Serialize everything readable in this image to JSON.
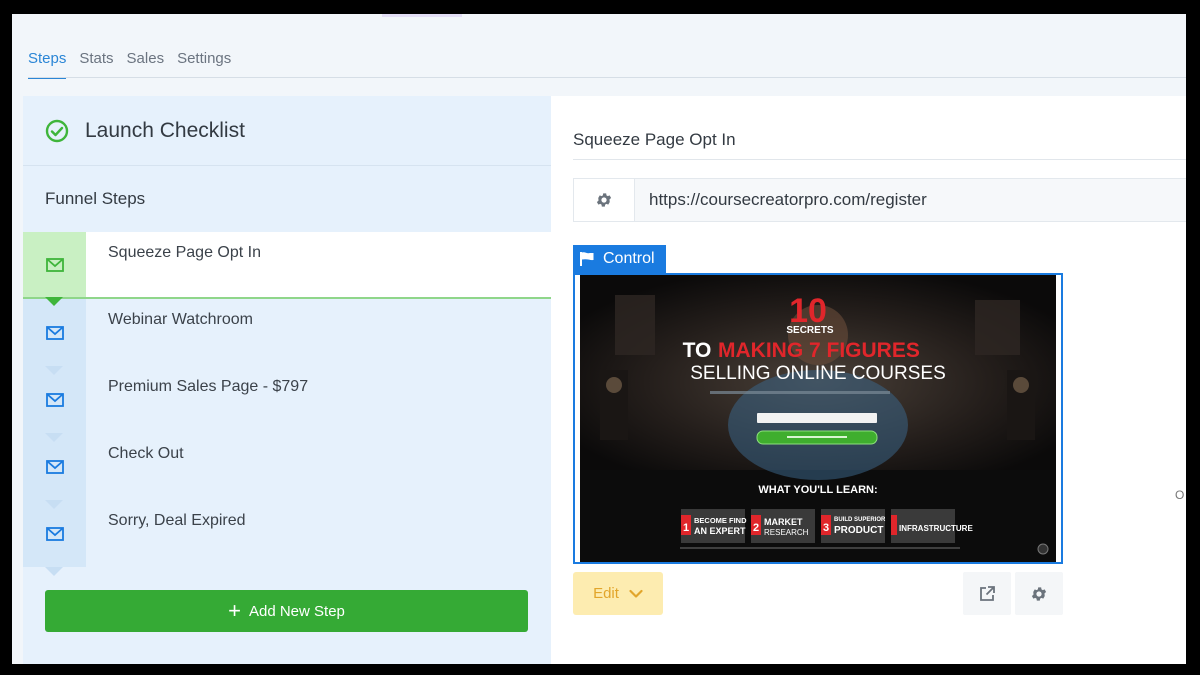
{
  "tabs": [
    {
      "label": "Steps",
      "active": true
    },
    {
      "label": "Stats",
      "active": false
    },
    {
      "label": "Sales",
      "active": false
    },
    {
      "label": "Settings",
      "active": false
    }
  ],
  "checklist": {
    "title": "Launch Checklist"
  },
  "funnel": {
    "label": "Funnel Steps",
    "steps": [
      {
        "label": "Squeeze Page Opt In",
        "active": true
      },
      {
        "label": "Webinar Watchroom",
        "active": false
      },
      {
        "label": "Premium Sales Page - $797",
        "active": false
      },
      {
        "label": "Check Out",
        "active": false
      },
      {
        "label": "Sorry, Deal Expired",
        "active": false
      }
    ],
    "add_label": "Add New Step"
  },
  "detail": {
    "page_name": "Squeeze Page Opt In",
    "url": "https://coursecreatorpro.com/register",
    "control_label": "Control",
    "edit_label": "Edit",
    "edge_text": "O"
  },
  "preview": {
    "headline_number": "10",
    "headline_secrets": "SECRETS",
    "headline_to": "TO",
    "headline_main": "MAKING 7 FIGURES",
    "headline_sub": "SELLING ONLINE COURSES",
    "learn_title": "WHAT YOU'LL LEARN:",
    "cards": [
      {
        "number": "1",
        "line1": "BECOME FIND",
        "line2": "AN EXPERT"
      },
      {
        "number": "2",
        "line1": "MARKET",
        "line2": "RESEARCH"
      },
      {
        "number": "3",
        "line1": "BUILD SUPERIOR",
        "line2": "PRODUCT"
      },
      {
        "number": "4",
        "line1": "",
        "line2": "INFRASTRUCTURE"
      }
    ]
  },
  "colors": {
    "accent": "#2b86d6",
    "control_blue": "#1a7be0",
    "add_green": "#35aa35",
    "active_green": "#3fb53b",
    "edit_yellow_bg": "#fdecb0",
    "edit_yellow_text": "#e2a52b",
    "headline_red": "#e0262b"
  },
  "icons": {
    "checklist": "check-circle-icon",
    "step": "envelope-icon",
    "gear": "gear-icon",
    "flag": "flag-icon",
    "external": "external-link-icon",
    "chevron": "chevron-down-icon",
    "plus": "plus-icon"
  }
}
